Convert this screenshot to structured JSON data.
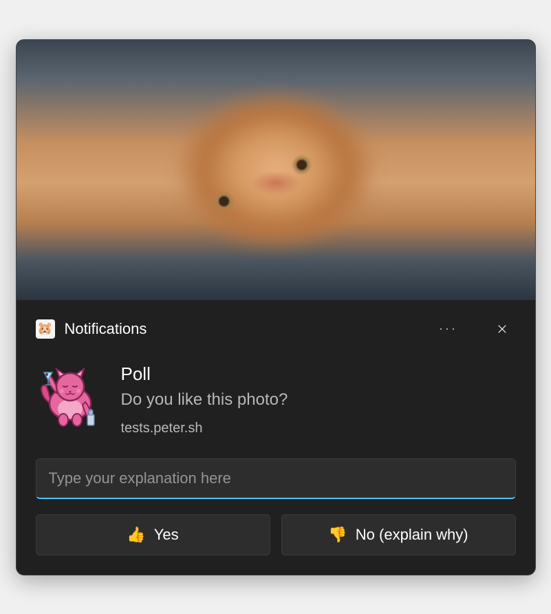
{
  "header": {
    "app_icon": "🐹",
    "app_name": "Notifications"
  },
  "body": {
    "avatar_icon": "party-cat-icon",
    "title": "Poll",
    "message": "Do you like this photo?",
    "source": "tests.peter.sh"
  },
  "input": {
    "placeholder": "Type your explanation here",
    "value": ""
  },
  "buttons": {
    "yes": {
      "emoji": "👍",
      "label": "Yes"
    },
    "no": {
      "emoji": "👎",
      "label": "No (explain why)"
    }
  }
}
